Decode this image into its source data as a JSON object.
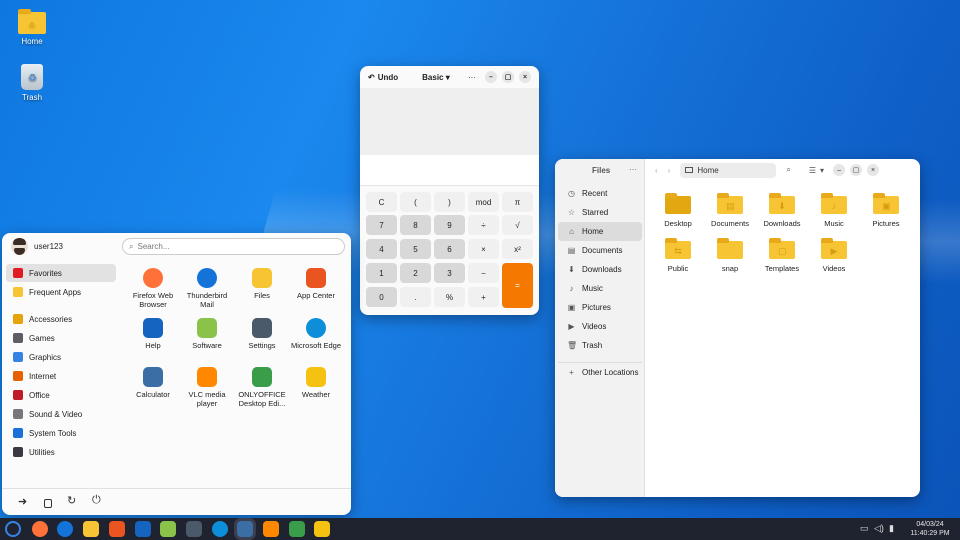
{
  "desktop": {
    "icons": [
      {
        "label": "Home",
        "icon": "home-folder-icon"
      },
      {
        "label": "Trash",
        "icon": "trash-icon"
      }
    ]
  },
  "calculator": {
    "undo_label": "Undo",
    "mode_label": "Basic",
    "menu_icon": "···",
    "min_icon": "–",
    "max_icon": "▢",
    "close_icon": "×",
    "keys": [
      "C",
      "(",
      ")",
      "mod",
      "π",
      "7",
      "8",
      "9",
      "÷",
      "√",
      "4",
      "5",
      "6",
      "×",
      "x²",
      "1",
      "2",
      "3",
      "−",
      "=",
      "0",
      ".",
      "%",
      "+"
    ],
    "equals_color": "#f57900"
  },
  "start_menu": {
    "username": "user123",
    "search_placeholder": "Search...",
    "categories": [
      {
        "label": "Favorites",
        "color": "#e01b24"
      },
      {
        "label": "Frequent Apps",
        "color": "#f7c533"
      },
      {
        "label": "Accessories",
        "color": "#e5a50a"
      },
      {
        "label": "Games",
        "color": "#5e5c64"
      },
      {
        "label": "Graphics",
        "color": "#3584e4"
      },
      {
        "label": "Internet",
        "color": "#e66100"
      },
      {
        "label": "Office",
        "color": "#c01c28"
      },
      {
        "label": "Sound & Video",
        "color": "#77767b"
      },
      {
        "label": "System Tools",
        "color": "#1c71d8"
      },
      {
        "label": "Utilities",
        "color": "#3d3846"
      }
    ],
    "apps": [
      {
        "label": "Firefox Web Browser",
        "color": "#ff7139"
      },
      {
        "label": "Thunderbird Mail",
        "color": "#1373d9"
      },
      {
        "label": "Files",
        "color": "#f7c533"
      },
      {
        "label": "App Center",
        "color": "#e95420"
      },
      {
        "label": "Help",
        "color": "#1565c0"
      },
      {
        "label": "Software",
        "color": "#8bc34a"
      },
      {
        "label": "Settings",
        "color": "#4a5a6a"
      },
      {
        "label": "Microsoft Edge",
        "color": "#0c8fd8"
      },
      {
        "label": "Calculator",
        "color": "#3b6ea5"
      },
      {
        "label": "VLC media player",
        "color": "#ff8800"
      },
      {
        "label": "ONLYOFFICE Desktop Edi...",
        "color": "#3a9d4a"
      },
      {
        "label": "Weather",
        "color": "#f5c211"
      }
    ],
    "bottom_icons": [
      "logout-icon",
      "lock-icon",
      "restart-icon",
      "power-icon"
    ]
  },
  "files": {
    "title": "Files",
    "location": "Home",
    "sidebar": [
      {
        "label": "Recent",
        "icon": "◷"
      },
      {
        "label": "Starred",
        "icon": "☆"
      },
      {
        "label": "Home",
        "icon": "⌂"
      },
      {
        "label": "Documents",
        "icon": "▤"
      },
      {
        "label": "Downloads",
        "icon": "⬇"
      },
      {
        "label": "Music",
        "icon": "♪"
      },
      {
        "label": "Pictures",
        "icon": "▣"
      },
      {
        "label": "Videos",
        "icon": "▶"
      },
      {
        "label": "Trash",
        "icon": "🗑"
      },
      {
        "label": "Other Locations",
        "icon": "+"
      }
    ],
    "folders": [
      {
        "label": "Desktop",
        "glyph": ""
      },
      {
        "label": "Documents",
        "glyph": "▤"
      },
      {
        "label": "Downloads",
        "glyph": "⬇"
      },
      {
        "label": "Music",
        "glyph": "♪"
      },
      {
        "label": "Pictures",
        "glyph": "▣"
      },
      {
        "label": "Public",
        "glyph": "⇆"
      },
      {
        "label": "snap",
        "glyph": ""
      },
      {
        "label": "Templates",
        "glyph": "▢"
      },
      {
        "label": "Videos",
        "glyph": "▶"
      }
    ]
  },
  "taskbar": {
    "date": "04/03/24",
    "time": "11:40:29 PM",
    "app_colors": [
      "#3584e4",
      "#ff7139",
      "#1373d9",
      "#f7c533",
      "#e95420",
      "#1565c0",
      "#8bc34a",
      "#4a5a6a",
      "#0c8fd8",
      "#3b6ea5",
      "#ff8800",
      "#3a9d4a",
      "#f5c211"
    ],
    "tray_icons": [
      "network-icon",
      "volume-icon",
      "battery-icon"
    ]
  }
}
